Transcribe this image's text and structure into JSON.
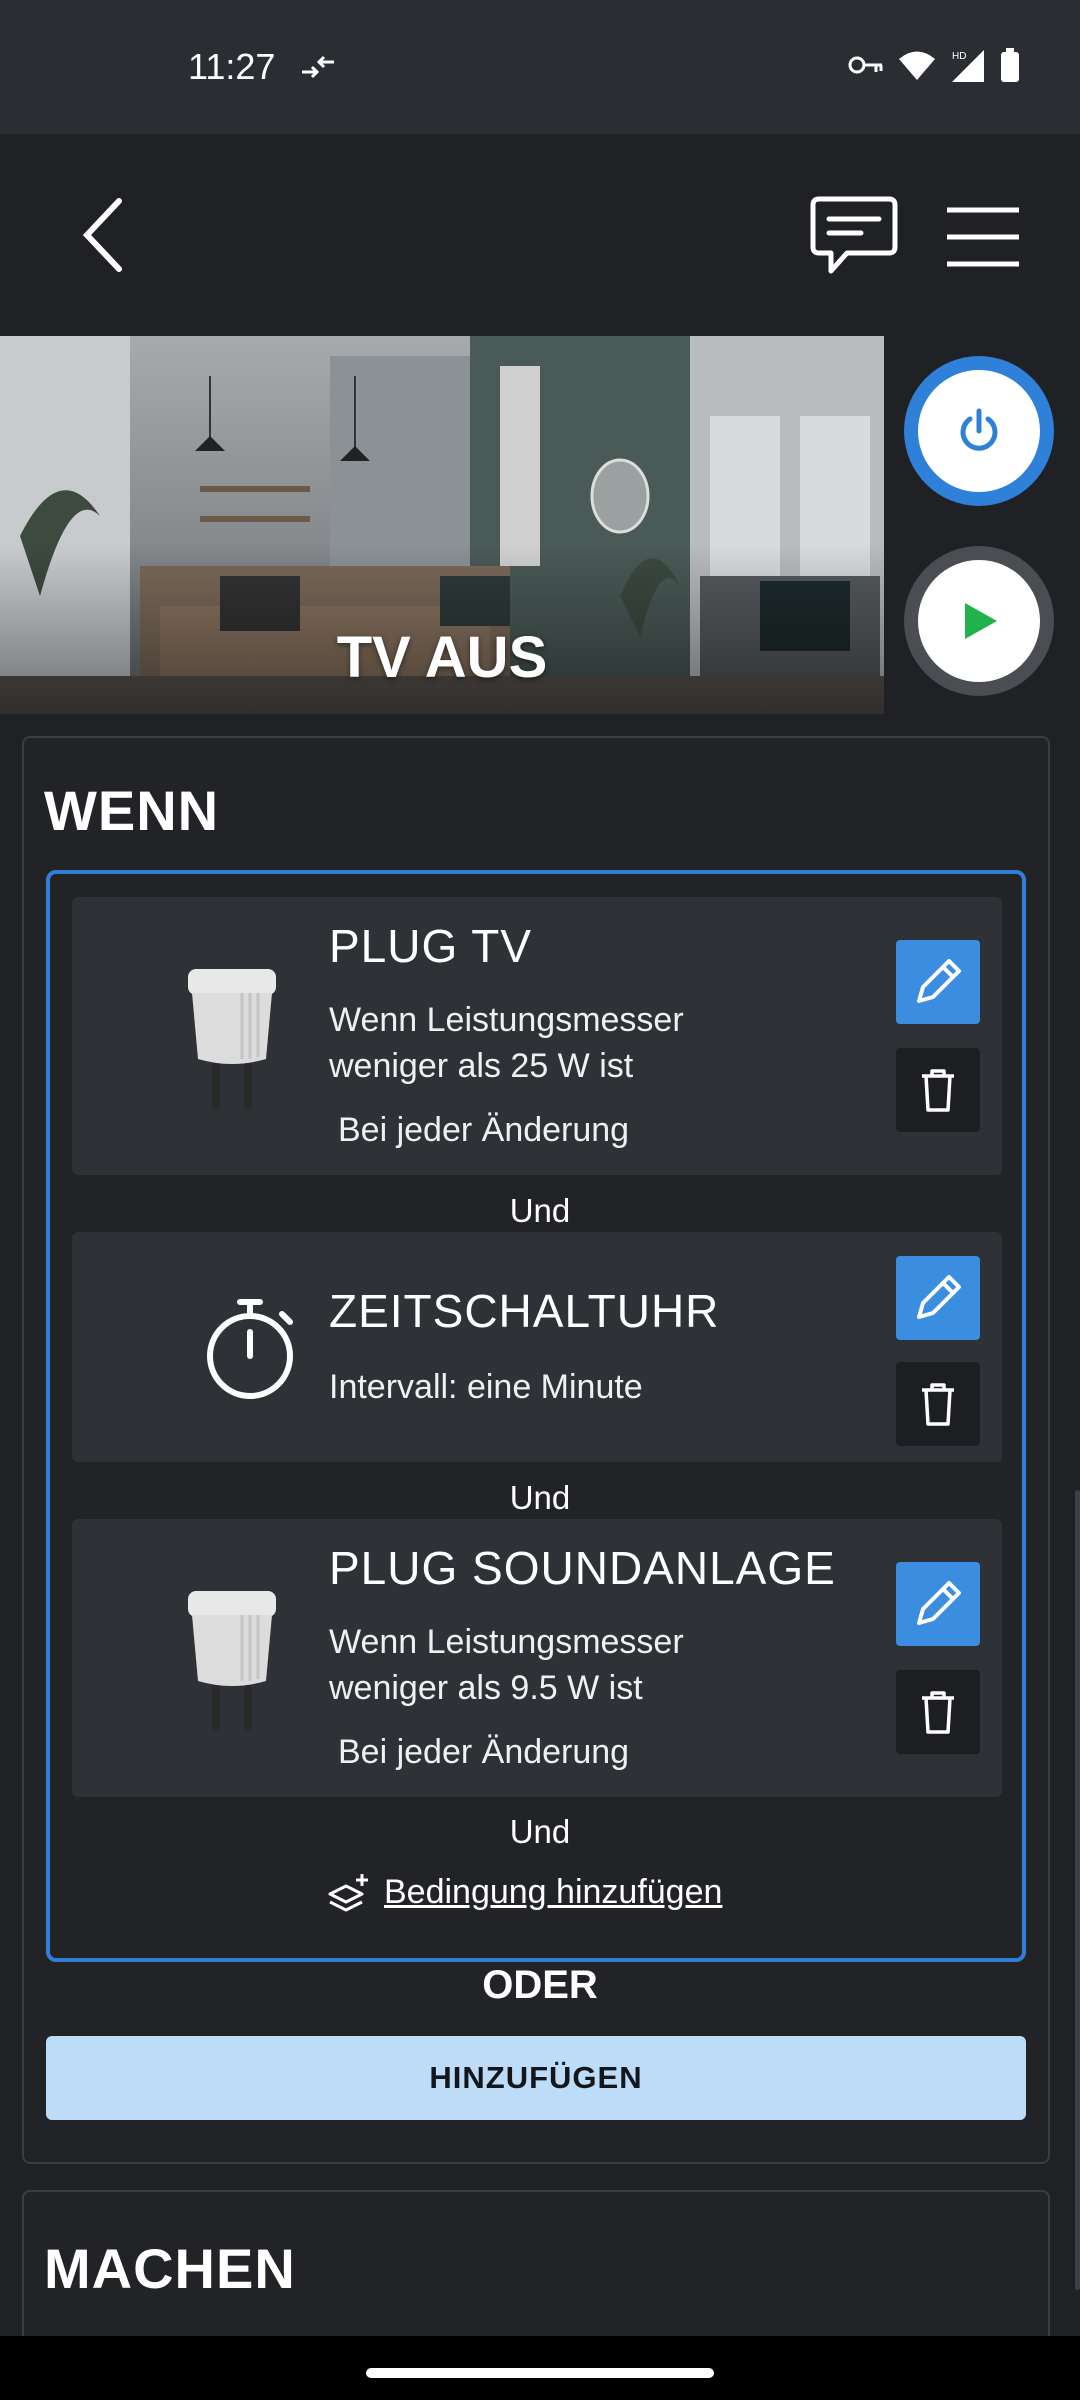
{
  "status_bar": {
    "time": "11:27"
  },
  "scene": {
    "title": "TV AUS"
  },
  "wenn": {
    "title": "WENN",
    "conditions": [
      {
        "title": "PLUG TV",
        "desc_line1": "Wenn Leistungsmesser",
        "desc_line2": "weniger als 25 W ist",
        "trigger": "Bei jeder Änderung",
        "icon": "smart-plug-image"
      },
      {
        "title": "ZEITSCHALTUHR",
        "desc_line1": "Intervall: eine Minute",
        "icon": "stopwatch-icon"
      },
      {
        "title": "PLUG SOUNDANLAGE",
        "desc_line1": "Wenn Leistungsmesser",
        "desc_line2": "weniger als 9.5 W ist",
        "trigger": "Bei jeder Änderung",
        "icon": "smart-plug-image"
      }
    ],
    "connector": "Und",
    "add_condition": "Bedingung hinzufügen",
    "or_label": "ODER",
    "add_button": "HINZUFÜGEN"
  },
  "machen": {
    "title": "MACHEN"
  },
  "colors": {
    "accent": "#3b8de0",
    "group_border": "#2f80d8",
    "add_button_bg": "#bcdcf8",
    "play_green": "#22b24c"
  }
}
